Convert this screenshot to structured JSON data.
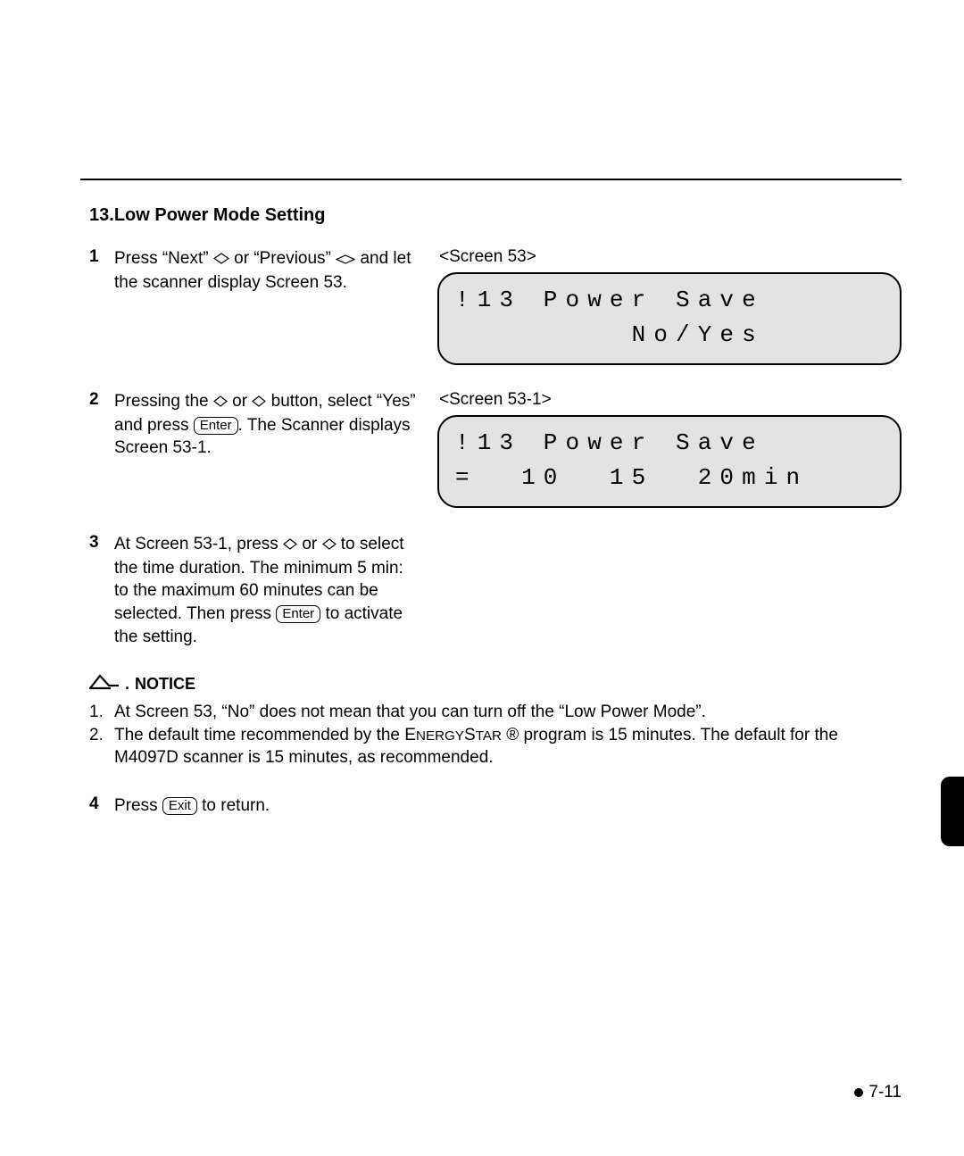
{
  "section": {
    "number": "13.",
    "title": "Low Power Mode Setting"
  },
  "steps": {
    "s1": {
      "num": "1",
      "textA": "Press “Next” ",
      "textB": " or “Previous” ",
      "textC": " and let the scanner display Screen 53."
    },
    "s2": {
      "num": "2",
      "textA": "Pressing the ",
      "textB": " or ",
      "textC": " button, select “Yes” and press ",
      "textD": ". The Scanner displays Screen 53-1."
    },
    "s3": {
      "num": "3",
      "textA": "At Screen 53-1, press  ",
      "textB": " or ",
      "textC": " to select the time duration. The minimum 5 min: to the maximum 60 minutes can be selected. Then press ",
      "textD": " to activate the setting."
    },
    "s4": {
      "num": "4",
      "textA": "Press ",
      "textB": " to return."
    }
  },
  "keys": {
    "enter": "Enter",
    "exit": "Exit"
  },
  "screens": {
    "a": {
      "label": "<Screen 53>",
      "line1": "!13 Power Save",
      "line2": "        No/Yes"
    },
    "b": {
      "label": "<Screen 53-1>",
      "line1": "!13 Power Save",
      "line2": "=  10  15  20min"
    }
  },
  "notice": {
    "label": "NOTICE",
    "items": {
      "n1": {
        "num": "1.",
        "text": "At Screen 53, “No” does not mean that you can turn off the “Low Power Mode”."
      },
      "n2": {
        "num": "2.",
        "textA": "The default time recommended by the ",
        "energystar": "EnergyStar",
        "textB": " ® program is 15 minutes.  The default for the M4097D scanner is 15 minutes, as recommended."
      }
    }
  },
  "pageNumber": "7-11"
}
